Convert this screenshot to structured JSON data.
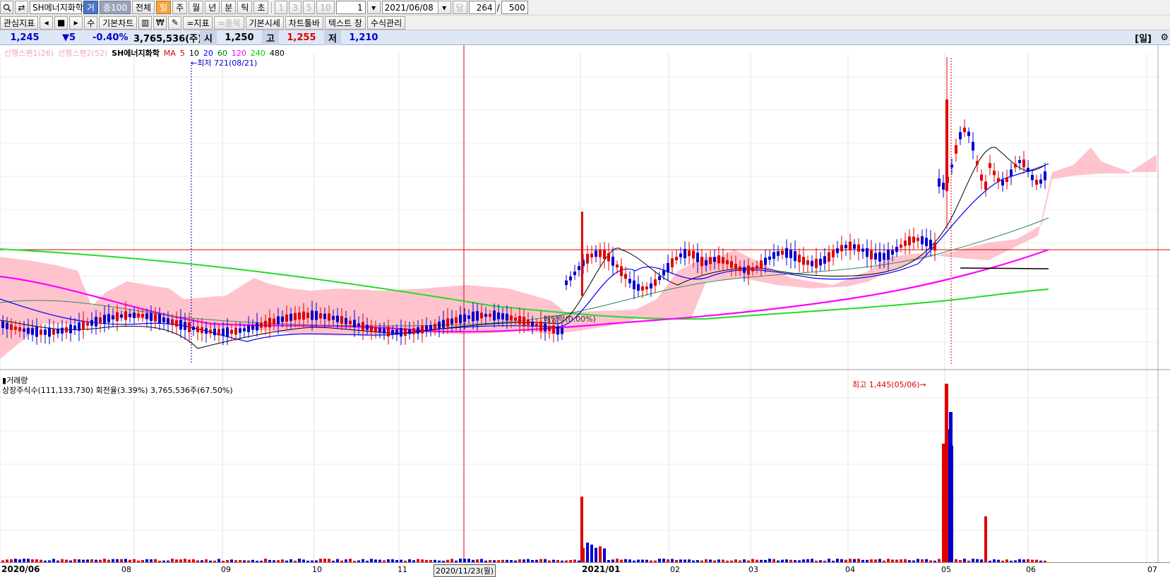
{
  "toolbar1": {
    "stock_name": "SH에너지화학",
    "trade_label": "거",
    "count_label": "종100",
    "all_label": "전체",
    "periods": [
      "일",
      "주",
      "월",
      "년",
      "분",
      "틱",
      "초"
    ],
    "active_period": "일",
    "minute_opts": [
      "1",
      "3",
      "5",
      "10"
    ],
    "unit_value": "1",
    "date_value": "2021/06/08",
    "count_prefix": "당",
    "count_value": "264",
    "count_slash": "/",
    "count_total": "500"
  },
  "toolbar2": {
    "interest_label": "관심지표",
    "su_label": "수",
    "basic_chart_label": "기본차트",
    "indicator_label": "=지표",
    "item_label": "=종목",
    "basic_price_label": "기본시세",
    "chart_toolbar_label": "차트툴바",
    "text_window_label": "텍스트 창",
    "formula_label": "수식관리"
  },
  "quote": {
    "price": "1,245",
    "change": "▼5",
    "change_pct": "-0.40%",
    "volume": "3,765,536(주)",
    "open_label": "시",
    "open": "1,250",
    "high_label": "고",
    "high": "1,255",
    "low_label": "저",
    "low": "1,210",
    "period": "[일]"
  },
  "legend": {
    "span1": "선행스팬1(26)",
    "span2": "선행스팬2(52)",
    "stock": "SH에너지화학",
    "ma_label": "MA",
    "ma_periods": [
      "5",
      "10",
      "20",
      "60",
      "120",
      "240",
      "480"
    ],
    "ma_colors": [
      "#e00000",
      "#000000",
      "#0000ff",
      "#008000",
      "#ff00ff",
      "#00cc00",
      "#000000"
    ]
  },
  "annotations": {
    "low": "최저 721(08/21)",
    "high": "최고 1,445(05/06)",
    "dividend": "배당락(0.00%)"
  },
  "volume_panel": {
    "title": "거래량",
    "info": "상장주식수(111,133,730) 회전율(3.39%) 3,765,536주(67.50%)"
  },
  "x_axis": {
    "labels": [
      "2020/06",
      "08",
      "09",
      "10",
      "11",
      "2020/11/23(월)",
      "2021/01",
      "02",
      "03",
      "04",
      "05",
      "06",
      "07"
    ]
  },
  "colors": {
    "up": "#e00000",
    "down": "#0000d0",
    "cloud": "#ffc0cb",
    "crosshair": "#e00000"
  }
}
